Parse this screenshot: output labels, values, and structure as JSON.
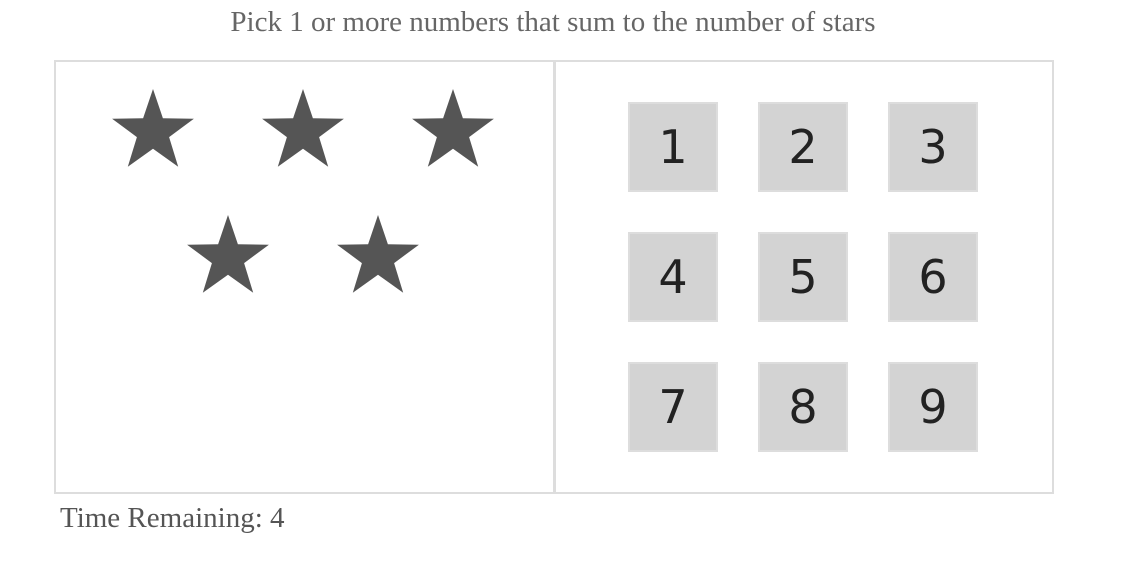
{
  "help_text": "Pick 1 or more numbers that sum to the number of stars",
  "stars": {
    "count": 5,
    "icon": "star-icon",
    "color": "#555555"
  },
  "numbers": [
    {
      "label": "1"
    },
    {
      "label": "2"
    },
    {
      "label": "3"
    },
    {
      "label": "4"
    },
    {
      "label": "5"
    },
    {
      "label": "6"
    },
    {
      "label": "7"
    },
    {
      "label": "8"
    },
    {
      "label": "9"
    }
  ],
  "timer": {
    "label": "Time Remaining: ",
    "value": "4"
  },
  "colors": {
    "number_bg": "#d3d3d3",
    "border": "#dddddd",
    "text": "#555555"
  }
}
